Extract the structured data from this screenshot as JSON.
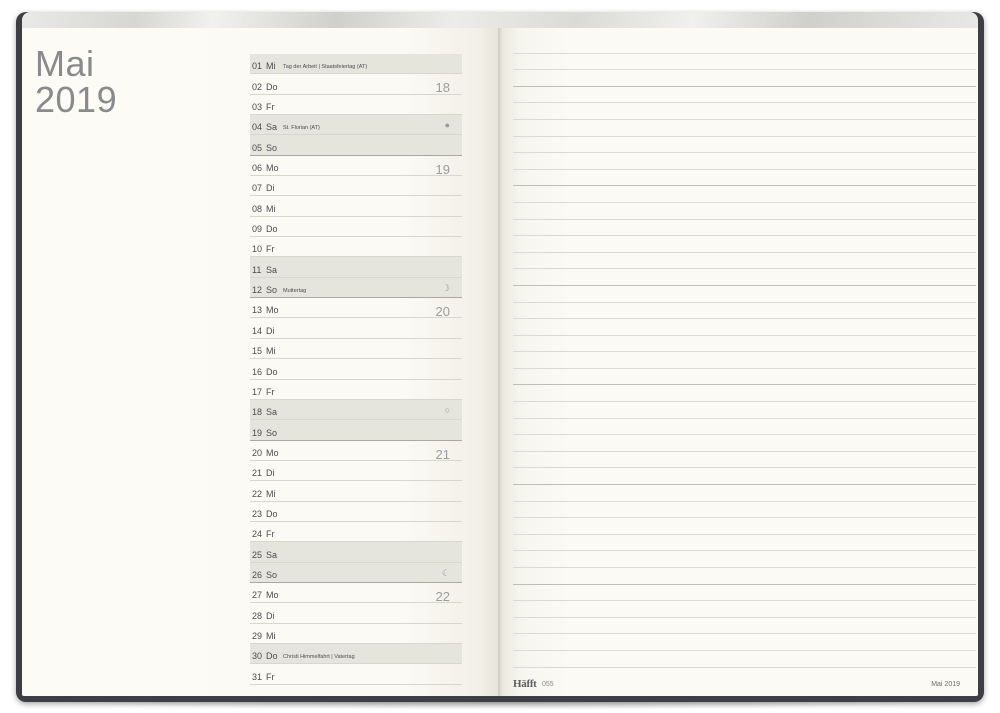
{
  "title": {
    "month": "Mai",
    "year": "2019"
  },
  "days": [
    {
      "num": "01",
      "wd": "Mi",
      "holiday": "Tag der Arbeit | Staatsfeiertag (AT)",
      "week": "",
      "moon": ""
    },
    {
      "num": "02",
      "wd": "Do",
      "holiday": "",
      "week": "18",
      "moon": ""
    },
    {
      "num": "03",
      "wd": "Fr",
      "holiday": "",
      "week": "",
      "moon": ""
    },
    {
      "num": "04",
      "wd": "Sa",
      "holiday": "St. Florian (AT)",
      "week": "",
      "moon": "●"
    },
    {
      "num": "05",
      "wd": "So",
      "holiday": "",
      "week": "",
      "moon": ""
    },
    {
      "num": "06",
      "wd": "Mo",
      "holiday": "",
      "week": "19",
      "moon": ""
    },
    {
      "num": "07",
      "wd": "Di",
      "holiday": "",
      "week": "",
      "moon": ""
    },
    {
      "num": "08",
      "wd": "Mi",
      "holiday": "",
      "week": "",
      "moon": ""
    },
    {
      "num": "09",
      "wd": "Do",
      "holiday": "",
      "week": "",
      "moon": ""
    },
    {
      "num": "10",
      "wd": "Fr",
      "holiday": "",
      "week": "",
      "moon": ""
    },
    {
      "num": "11",
      "wd": "Sa",
      "holiday": "",
      "week": "",
      "moon": ""
    },
    {
      "num": "12",
      "wd": "So",
      "holiday": "Muttertag",
      "week": "",
      "moon": "☽"
    },
    {
      "num": "13",
      "wd": "Mo",
      "holiday": "",
      "week": "20",
      "moon": ""
    },
    {
      "num": "14",
      "wd": "Di",
      "holiday": "",
      "week": "",
      "moon": ""
    },
    {
      "num": "15",
      "wd": "Mi",
      "holiday": "",
      "week": "",
      "moon": ""
    },
    {
      "num": "16",
      "wd": "Do",
      "holiday": "",
      "week": "",
      "moon": ""
    },
    {
      "num": "17",
      "wd": "Fr",
      "holiday": "",
      "week": "",
      "moon": ""
    },
    {
      "num": "18",
      "wd": "Sa",
      "holiday": "",
      "week": "",
      "moon": "○"
    },
    {
      "num": "19",
      "wd": "So",
      "holiday": "",
      "week": "",
      "moon": ""
    },
    {
      "num": "20",
      "wd": "Mo",
      "holiday": "",
      "week": "21",
      "moon": ""
    },
    {
      "num": "21",
      "wd": "Di",
      "holiday": "",
      "week": "",
      "moon": ""
    },
    {
      "num": "22",
      "wd": "Mi",
      "holiday": "",
      "week": "",
      "moon": ""
    },
    {
      "num": "23",
      "wd": "Do",
      "holiday": "",
      "week": "",
      "moon": ""
    },
    {
      "num": "24",
      "wd": "Fr",
      "holiday": "",
      "week": "",
      "moon": ""
    },
    {
      "num": "25",
      "wd": "Sa",
      "holiday": "",
      "week": "",
      "moon": ""
    },
    {
      "num": "26",
      "wd": "So",
      "holiday": "",
      "week": "",
      "moon": "☾"
    },
    {
      "num": "27",
      "wd": "Mo",
      "holiday": "",
      "week": "22",
      "moon": ""
    },
    {
      "num": "28",
      "wd": "Di",
      "holiday": "",
      "week": "",
      "moon": ""
    },
    {
      "num": "29",
      "wd": "Mi",
      "holiday": "",
      "week": "",
      "moon": ""
    },
    {
      "num": "30",
      "wd": "Do",
      "holiday": "Christi Himmelfahrt | Vatertag",
      "week": "",
      "moon": ""
    },
    {
      "num": "31",
      "wd": "Fr",
      "holiday": "",
      "week": "",
      "moon": ""
    }
  ],
  "footer": {
    "brand": "Häfft",
    "page_number": "055",
    "month_label": "Mai 2019"
  },
  "colors": {
    "page": "#fbfaf4",
    "cover": "#3d3f44",
    "weekend": "#e6e5dd",
    "text": "#4a4c4e"
  }
}
